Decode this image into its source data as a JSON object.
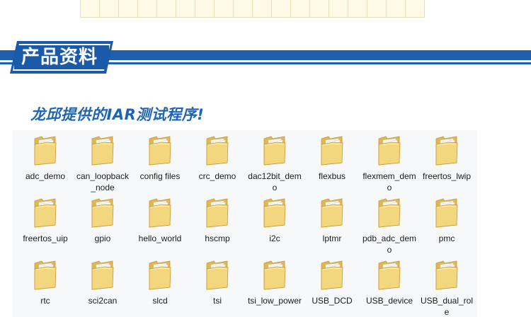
{
  "section": {
    "title": "产品资料",
    "subtitle": "龙邱提供的IAR测试程序!"
  },
  "colors": {
    "brand_blue": "#1a5aa8",
    "folder_yellow": "#f3d77e"
  },
  "folders": [
    {
      "name": "adc_demo"
    },
    {
      "name": "can_loopback_node"
    },
    {
      "name": "config files"
    },
    {
      "name": "crc_demo"
    },
    {
      "name": "dac12bit_demo"
    },
    {
      "name": "flexbus"
    },
    {
      "name": "flexmem_demo"
    },
    {
      "name": "freertos_lwip"
    },
    {
      "name": "freertos_uip"
    },
    {
      "name": "gpio"
    },
    {
      "name": "hello_world"
    },
    {
      "name": "hscmp"
    },
    {
      "name": "i2c"
    },
    {
      "name": "lptmr"
    },
    {
      "name": "pdb_adc_demo"
    },
    {
      "name": "pmc"
    },
    {
      "name": "rtc"
    },
    {
      "name": "sci2can"
    },
    {
      "name": "slcd"
    },
    {
      "name": "tsi"
    },
    {
      "name": "tsi_low_power"
    },
    {
      "name": "USB_DCD"
    },
    {
      "name": "USB_device"
    },
    {
      "name": "USB_dual_role"
    }
  ]
}
